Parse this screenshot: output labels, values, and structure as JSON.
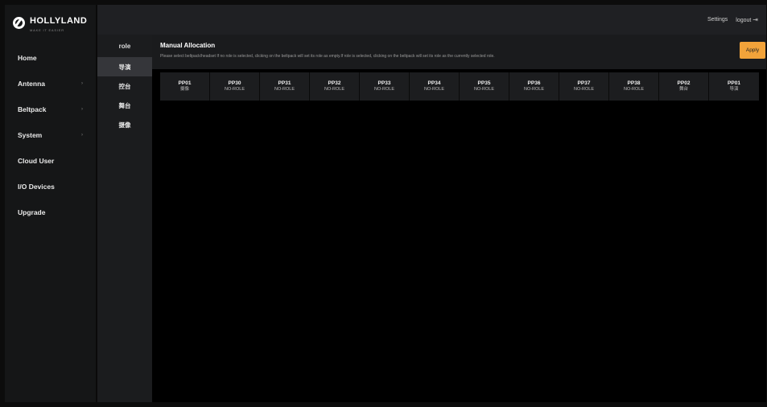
{
  "brand": {
    "name": "HOLLYLAND",
    "tagline": "MAKE IT EASIER"
  },
  "header": {
    "settings_label": "Settings",
    "logout_label": "logout"
  },
  "sidebar": {
    "items": [
      {
        "label": "Home",
        "has_arrow": false
      },
      {
        "label": "Antenna",
        "has_arrow": true
      },
      {
        "label": "Beltpack",
        "has_arrow": true
      },
      {
        "label": "System",
        "has_arrow": true
      },
      {
        "label": "Cloud User",
        "has_arrow": false
      },
      {
        "label": "I/O Devices",
        "has_arrow": false
      },
      {
        "label": "Upgrade",
        "has_arrow": false
      }
    ]
  },
  "roles": {
    "title": "role",
    "items": [
      "导演",
      "控台",
      "舞台",
      "摄像"
    ],
    "selected": "导演"
  },
  "main": {
    "title": "Manual Allocation",
    "description": "Please select beltpack/headset If no role is selected, clicking on the beltpack will set its role as empty.If role is selected, clicking on the beltpack will set its role as the currently selected role.",
    "apply_label": "Apply"
  },
  "beltpacks": [
    {
      "id": "PP01",
      "role": "摄像"
    },
    {
      "id": "PP30",
      "role": "NO-ROLE"
    },
    {
      "id": "PP31",
      "role": "NO-ROLE"
    },
    {
      "id": "PP32",
      "role": "NO-ROLE"
    },
    {
      "id": "PP33",
      "role": "NO-ROLE"
    },
    {
      "id": "PP34",
      "role": "NO-ROLE"
    },
    {
      "id": "PP35",
      "role": "NO-ROLE"
    },
    {
      "id": "PP36",
      "role": "NO-ROLE"
    },
    {
      "id": "PP37",
      "role": "NO-ROLE"
    },
    {
      "id": "PP38",
      "role": "NO-ROLE"
    },
    {
      "id": "PP02",
      "role": "舞台"
    },
    {
      "id": "PP01",
      "role": "导演"
    }
  ],
  "colors": {
    "accent": "#f2a33a",
    "sidebar_bg": "#151617",
    "header_bg": "#1f2023"
  }
}
